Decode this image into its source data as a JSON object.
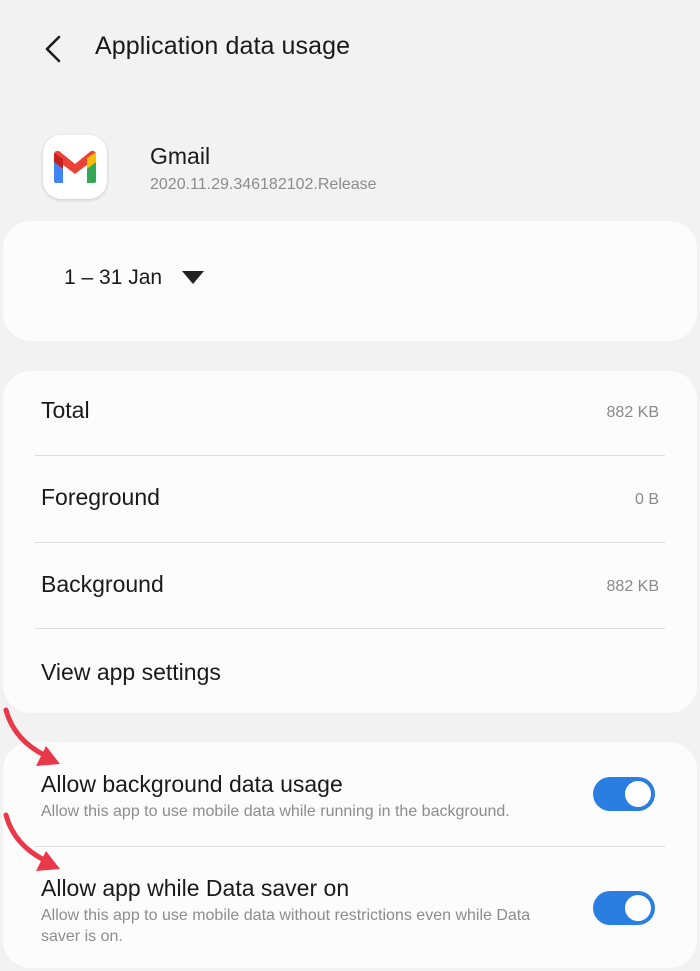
{
  "header": {
    "title": "Application data usage",
    "back_icon": "chevron-left-icon"
  },
  "app": {
    "name": "Gmail",
    "version": "2020.11.29.346182102.Release",
    "icon": "gmail-icon"
  },
  "date_range": {
    "label": "1 – 31 Jan",
    "icon": "dropdown-triangle-icon"
  },
  "usage": {
    "rows": [
      {
        "label": "Total",
        "value": "882 KB"
      },
      {
        "label": "Foreground",
        "value": "0 B"
      },
      {
        "label": "Background",
        "value": "882 KB"
      }
    ],
    "settings_link": "View app settings"
  },
  "toggles": [
    {
      "title": "Allow background data usage",
      "description": "Allow this app to use mobile data while running in the background.",
      "enabled": true
    },
    {
      "title": "Allow app while Data saver on",
      "description": "Allow this app to use mobile data without restrictions even while Data saver is on.",
      "enabled": true
    }
  ],
  "colors": {
    "accent": "#2a7de1",
    "annotation_arrow": "#e8384a",
    "background": "#f2f2f2",
    "card": "#fcfcfc"
  }
}
